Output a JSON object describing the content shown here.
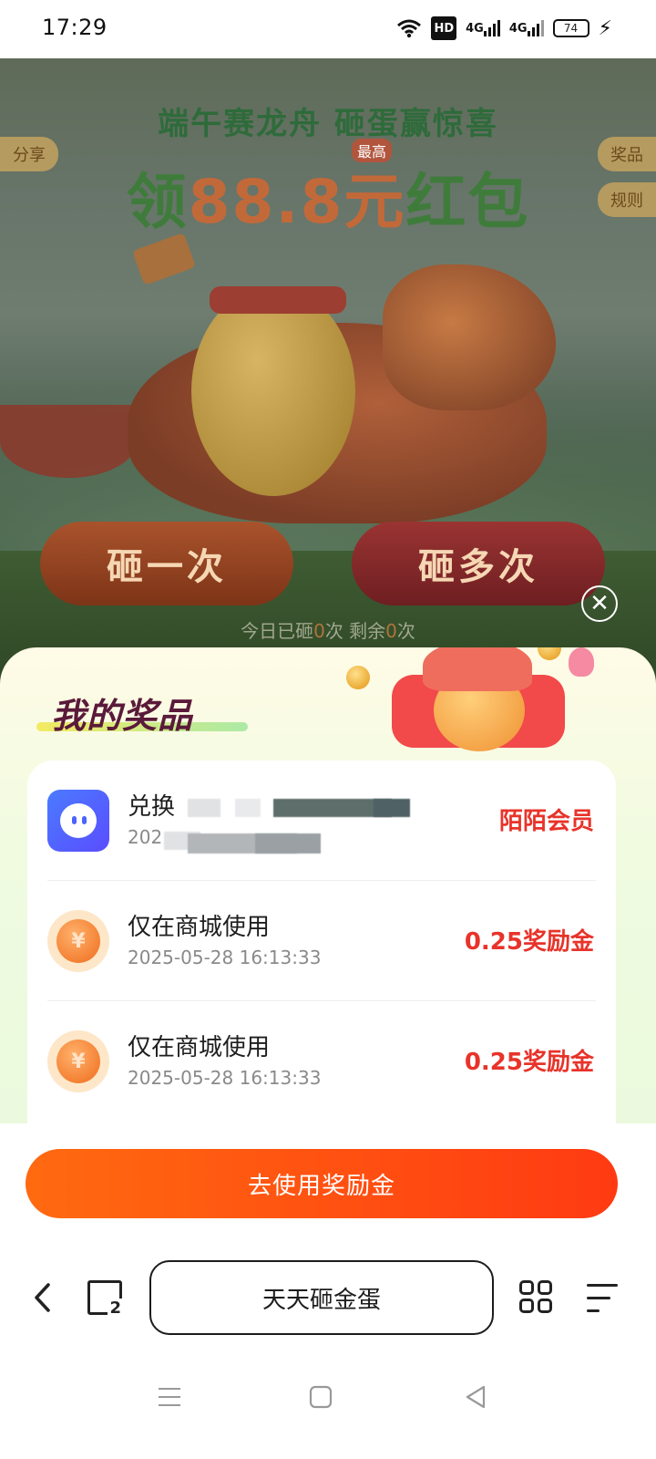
{
  "status_bar": {
    "time": "17:29",
    "hd": "HD",
    "net1": "4G",
    "net2": "4G",
    "battery": "74"
  },
  "promo": {
    "headline": "端午赛龙舟 砸蛋赢惊喜",
    "main_prefix": "领",
    "main_amount": "88.8元",
    "main_suffix": "红包",
    "badge": "最高",
    "share_label": "分享",
    "prizes_label": "奖品",
    "rules_label": "规则",
    "hit_once_label": "砸一次",
    "hit_multi_label": "砸多次",
    "today_prefix": "今日已砸",
    "today_hits": "0",
    "today_mid": "次 剩余",
    "today_remaining": "0",
    "today_suffix": "次"
  },
  "sheet": {
    "title": "我的奖品",
    "items": [
      {
        "icon": "momo-app-icon",
        "title_visible": "兑换",
        "date_visible": "202",
        "value": "陌陌会员",
        "redacted": true
      },
      {
        "icon": "coin-icon",
        "title_visible": "仅在商城使用",
        "date_visible": "2025-05-28 16:13:33",
        "value": "0.25奖励金",
        "redacted": false
      },
      {
        "icon": "coin-icon",
        "title_visible": "仅在商城使用",
        "date_visible": "2025-05-28 16:13:33",
        "value": "0.25奖励金",
        "redacted": false
      }
    ],
    "use_button_label": "去使用奖励金"
  },
  "toolbar": {
    "address_text": "天天砸金蛋",
    "tab_count": "2"
  },
  "colors": {
    "accent_orange": "#ff5a12",
    "value_red": "#e8332a",
    "sheet_title": "#5a1a3a"
  }
}
